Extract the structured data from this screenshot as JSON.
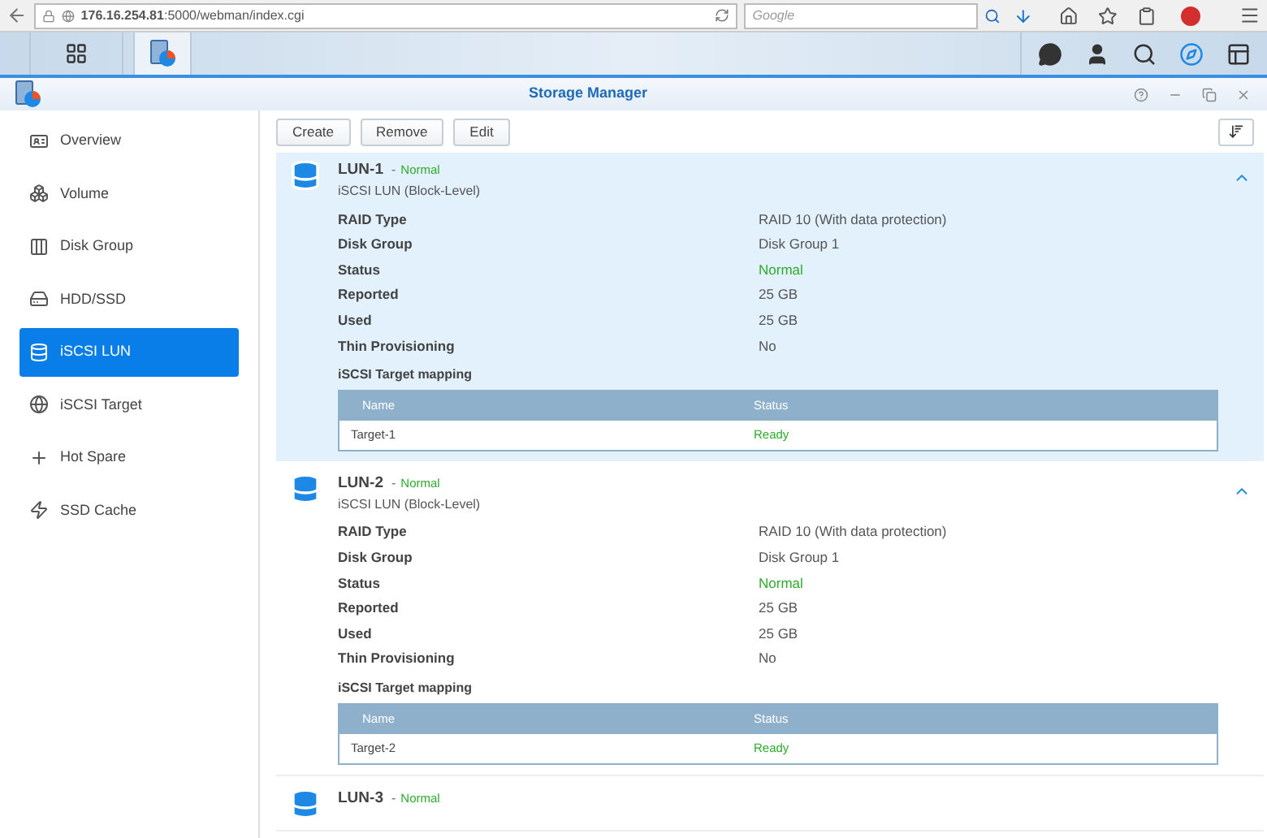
{
  "browser": {
    "url": "**176.16.254.81**:5000/webman/index.cgi",
    "search": {
      "placeholder": "Google"
    }
  },
  "window": {
    "title": "Storage Manager"
  },
  "sidebar": {
    "items": [
      {
        "label": "Overview",
        "kind": "overview",
        "selected": false
      },
      {
        "label": "Volume",
        "kind": "volume",
        "selected": false
      },
      {
        "label": "Disk Group",
        "kind": "diskgroup",
        "selected": false
      },
      {
        "label": "HDD/SSD",
        "kind": "hdd",
        "selected": false
      },
      {
        "label": "iSCSI LUN",
        "kind": "lun",
        "selected": true
      },
      {
        "label": "iSCSI Target",
        "kind": "target",
        "selected": false
      },
      {
        "label": "Hot Spare",
        "kind": "spare",
        "selected": false
      },
      {
        "label": "SSD Cache",
        "kind": "cache",
        "selected": false
      }
    ]
  },
  "toolbar": {
    "buttons": [
      "Create",
      "Remove",
      "Edit"
    ]
  },
  "luns": [
    {
      "name": "LUN-1",
      "separator": "-",
      "status": "Normal",
      "subtitle": "iSCSI LUN (Block-Level)",
      "selected": true,
      "expanded": true,
      "properties": [
        {
          "label": "RAID Type",
          "value": "RAID 10 (With data protection)",
          "kind": "plain"
        },
        {
          "label": "Disk Group",
          "value": "Disk Group 1",
          "kind": "plain"
        },
        {
          "label": "Status",
          "value": "Normal",
          "kind": "status"
        },
        {
          "label": "Reported",
          "value": "25 GB",
          "kind": "plain"
        },
        {
          "label": "Used",
          "value": "25 GB",
          "kind": "plain"
        },
        {
          "label": "Thin Provisioning",
          "value": "No",
          "kind": "plain"
        }
      ],
      "mapping": {
        "title": "iSCSI Target mapping",
        "columns": [
          "Name",
          "Status"
        ],
        "rows": [
          [
            "Target-1",
            "Ready"
          ]
        ]
      }
    },
    {
      "name": "LUN-2",
      "separator": "-",
      "status": "Normal",
      "subtitle": "iSCSI LUN (Block-Level)",
      "selected": false,
      "expanded": true,
      "properties": [
        {
          "label": "RAID Type",
          "value": "RAID 10 (With data protection)",
          "kind": "plain"
        },
        {
          "label": "Disk Group",
          "value": "Disk Group 1",
          "kind": "plain"
        },
        {
          "label": "Status",
          "value": "Normal",
          "kind": "status"
        },
        {
          "label": "Reported",
          "value": "25 GB",
          "kind": "plain"
        },
        {
          "label": "Used",
          "value": "25 GB",
          "kind": "plain"
        },
        {
          "label": "Thin Provisioning",
          "value": "No",
          "kind": "plain"
        }
      ],
      "mapping": {
        "title": "iSCSI Target mapping",
        "columns": [
          "Name",
          "Status"
        ],
        "rows": [
          [
            "Target-2",
            "Ready"
          ]
        ]
      }
    },
    {
      "name": "LUN-3",
      "separator": "-",
      "status": "Normal",
      "selected": false,
      "expanded": false
    }
  ]
}
